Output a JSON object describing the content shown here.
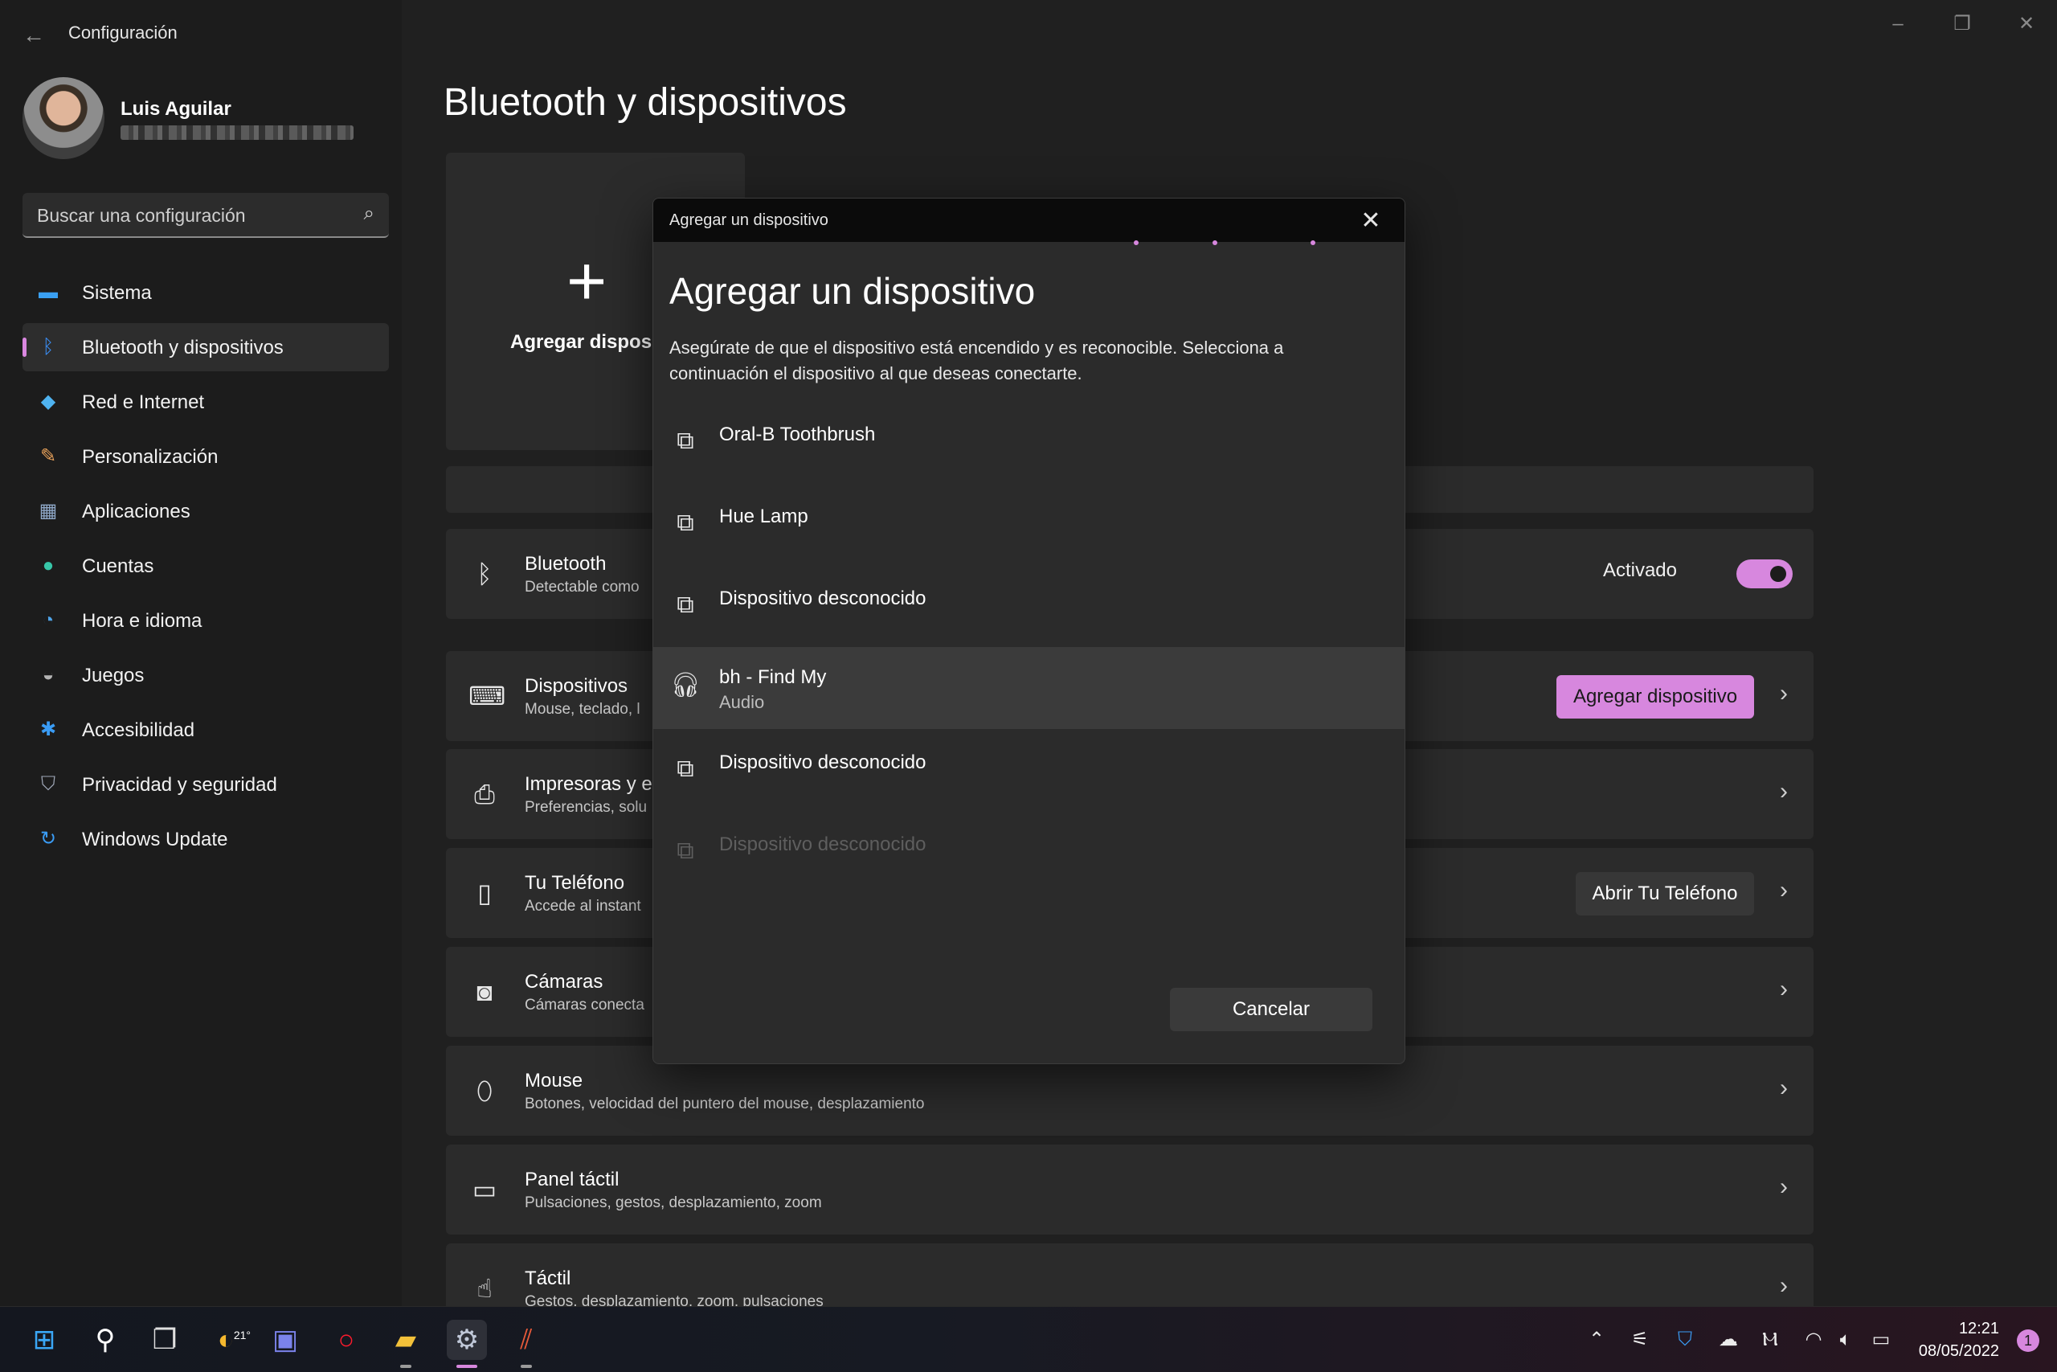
{
  "window": {
    "title": "Configuración",
    "back_icon": "arrow-left-icon",
    "controls": [
      "minimize-icon",
      "restore-icon",
      "close-icon"
    ]
  },
  "user": {
    "name": "Luis Aguilar"
  },
  "search": {
    "placeholder": "Buscar una configuración"
  },
  "sidebar": {
    "items": [
      {
        "label": "Sistema",
        "icon": "monitor-icon",
        "color": "#3aa0f3"
      },
      {
        "label": "Bluetooth y dispositivos",
        "icon": "bluetooth-icon",
        "color": "#3a8ef5",
        "active": true
      },
      {
        "label": "Red e Internet",
        "icon": "wifi-icon",
        "color": "#4fb3f0"
      },
      {
        "label": "Personalización",
        "icon": "brush-icon",
        "color": "#e9a25a"
      },
      {
        "label": "Aplicaciones",
        "icon": "apps-icon",
        "color": "#8fa8c8"
      },
      {
        "label": "Cuentas",
        "icon": "person-icon",
        "color": "#37c6a8"
      },
      {
        "label": "Hora e idioma",
        "icon": "globe-clock-icon",
        "color": "#4fa3e8"
      },
      {
        "label": "Juegos",
        "icon": "gamepad-icon",
        "color": "#b4b4b4"
      },
      {
        "label": "Accesibilidad",
        "icon": "accessibility-icon",
        "color": "#3a9cf5"
      },
      {
        "label": "Privacidad y seguridad",
        "icon": "shield-icon",
        "color": "#a0a8b8"
      },
      {
        "label": "Windows Update",
        "icon": "update-icon",
        "color": "#3a9cf5"
      }
    ]
  },
  "main": {
    "title": "Bluetooth y dispositivos",
    "add_card_label": "Agregar dispositivo",
    "rows": [
      {
        "title": "Bluetooth",
        "sub": "Detectable como",
        "icon": "bluetooth-icon",
        "toggle_label": "Activado"
      },
      {
        "title": "Dispositivos",
        "sub": "Mouse, teclado, l",
        "icon": "devices-icon",
        "button": "Agregar dispositivo"
      },
      {
        "title": "Impresoras y es",
        "sub": "Preferencias, solu",
        "icon": "printer-icon"
      },
      {
        "title": "Tu Teléfono",
        "sub": "Accede al instant",
        "icon": "phone-icon",
        "button": "Abrir Tu Teléfono"
      },
      {
        "title": "Cámaras",
        "sub": "Cámaras conecta",
        "icon": "camera-icon"
      },
      {
        "title": "Mouse",
        "sub": "Botones, velocidad del puntero del mouse, desplazamiento",
        "icon": "mouse-icon"
      },
      {
        "title": "Panel táctil",
        "sub": "Pulsaciones, gestos, desplazamiento, zoom",
        "icon": "touchpad-icon"
      },
      {
        "title": "Táctil",
        "sub": "Gestos, desplazamiento, zoom, pulsaciones",
        "icon": "touch-icon"
      }
    ]
  },
  "dialog": {
    "window_title": "Agregar un dispositivo",
    "heading": "Agregar un dispositivo",
    "description": "Asegúrate de que el dispositivo está encendido y es reconocible. Selecciona a continuación el dispositivo al que deseas conectarte.",
    "devices": [
      {
        "name": "Oral-B Toothbrush",
        "icon": "generic-device-icon"
      },
      {
        "name": "Hue Lamp",
        "icon": "generic-device-icon"
      },
      {
        "name": "Dispositivo desconocido",
        "icon": "generic-device-icon"
      },
      {
        "name": "bh - Find My",
        "type": "Audio",
        "icon": "headphones-icon",
        "selected": true
      },
      {
        "name": "Dispositivo desconocido",
        "icon": "generic-device-icon"
      },
      {
        "name": "Dispositivo desconocido",
        "icon": "generic-device-icon",
        "disabled": true
      }
    ],
    "cancel_label": "Cancelar"
  },
  "taskbar": {
    "apps": [
      "start-icon",
      "search-icon",
      "task-view-icon",
      "weather-icon",
      "chat-icon",
      "opera-icon",
      "file-explorer-icon",
      "settings-icon",
      "app-icon"
    ],
    "weather_temp": "21°",
    "tray": [
      "chevron-up-icon",
      "sliders-icon",
      "defender-icon",
      "onedrive-icon",
      "app-tray-icon",
      "wifi-icon",
      "volume-icon",
      "battery-icon"
    ],
    "time": "12:21",
    "date": "08/05/2022",
    "notifications": "1"
  },
  "colors": {
    "accent": "#d787de",
    "background": "#202020",
    "card": "#2b2b2b"
  }
}
